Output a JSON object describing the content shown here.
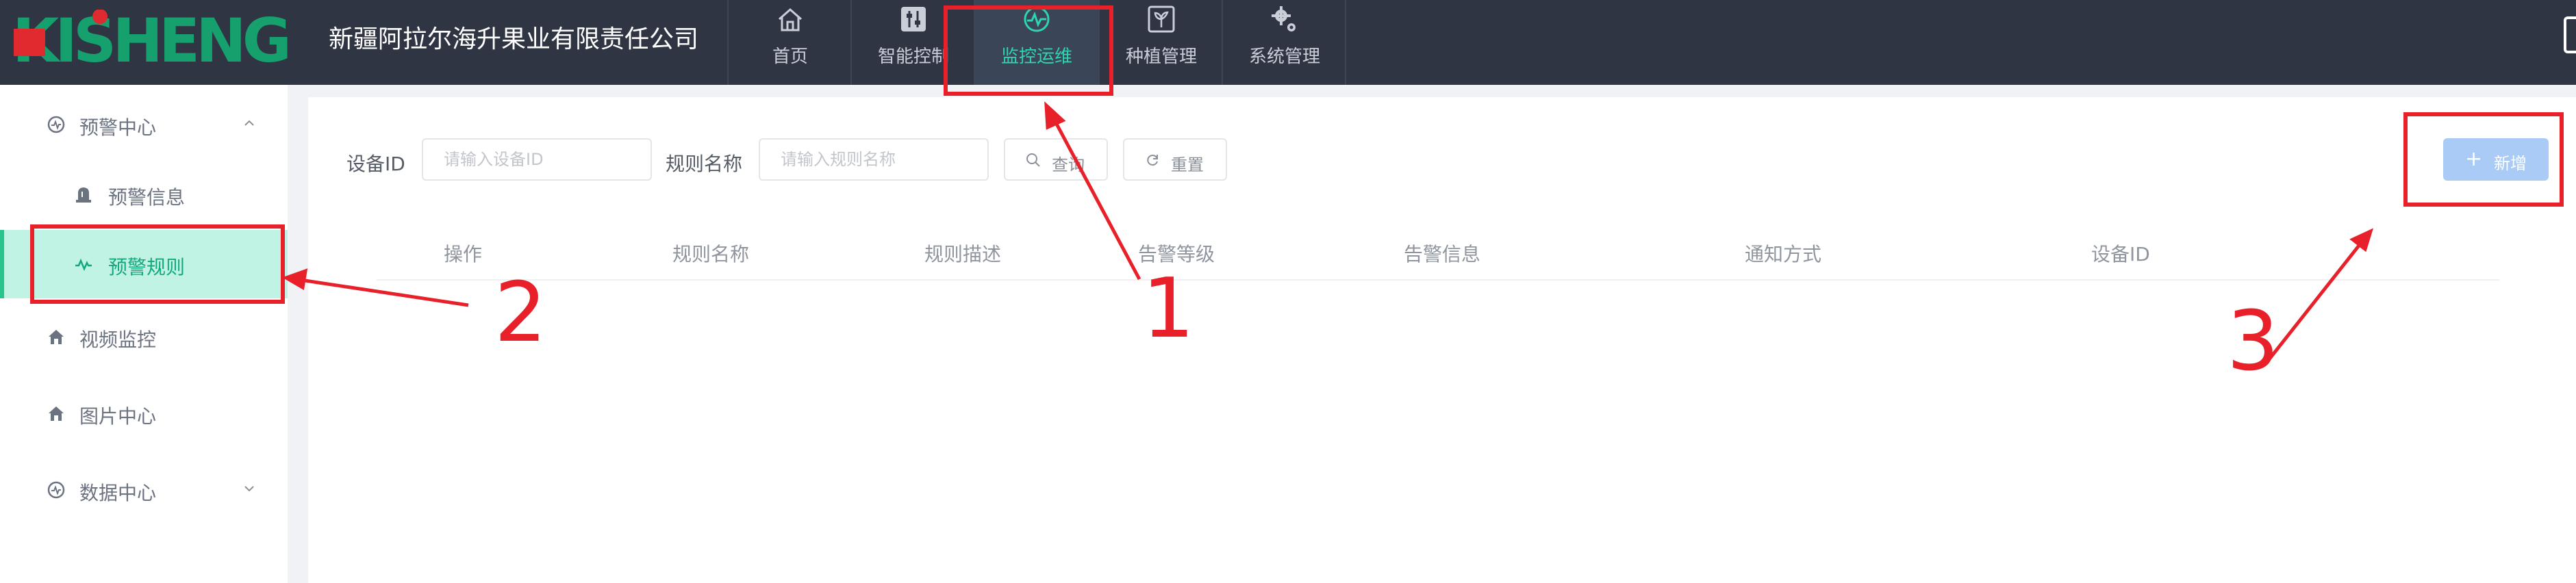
{
  "header": {
    "logo_text": "KISHENG",
    "company_name": "新疆阿拉尔海升果业有限责任公司",
    "nav": [
      {
        "label": "首页",
        "icon": "home-icon"
      },
      {
        "label": "智能控制",
        "icon": "sliders-icon"
      },
      {
        "label": "监控运维",
        "icon": "monitor-pulse-icon",
        "active": true
      },
      {
        "label": "种植管理",
        "icon": "plant-icon"
      },
      {
        "label": "系统管理",
        "icon": "gears-icon"
      }
    ]
  },
  "sidebar": {
    "items": [
      {
        "label": "预警中心",
        "icon": "alert-center-icon",
        "expanded": true
      },
      {
        "label": "预警信息",
        "icon": "alert-info-icon"
      },
      {
        "label": "预警规则",
        "icon": "pulse-icon",
        "active": true
      },
      {
        "label": "视频监控",
        "icon": "home-icon"
      },
      {
        "label": "图片中心",
        "icon": "home-icon"
      },
      {
        "label": "数据中心",
        "icon": "data-center-icon",
        "expanded": false
      }
    ]
  },
  "filters": {
    "device_id_label": "设备ID",
    "device_id_placeholder": "请输入设备ID",
    "device_id_value": "",
    "rule_name_label": "规则名称",
    "rule_name_placeholder": "请输入规则名称",
    "rule_name_value": "",
    "search_label": "查询",
    "reset_label": "重置",
    "add_label": "新增"
  },
  "table": {
    "columns": [
      "操作",
      "规则名称",
      "规则描述",
      "告警等级",
      "告警信息",
      "通知方式",
      "设备ID"
    ],
    "rows": []
  },
  "annotations": {
    "labels": [
      "1",
      "2",
      "3"
    ],
    "color": "#e8202a"
  },
  "colors": {
    "header_bg": "#2f3542",
    "accent": "#2ed5b0",
    "logo_red": "#e02a2f",
    "logo_green": "#15a06e",
    "sidebar_active_bg": "#c0f3e3",
    "add_button_bg": "#a9cbf6"
  }
}
